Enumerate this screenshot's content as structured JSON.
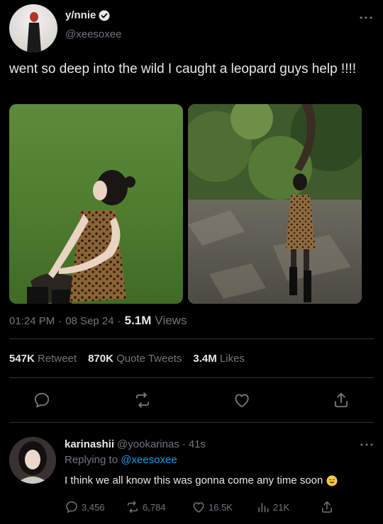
{
  "tweet": {
    "author_name": "y/nnie",
    "author_handle": "@xeesoxee",
    "text": "went so deep into the wild I caught a leopard guys help !!!!",
    "time": "01:24 PM",
    "date": "08 Sep 24",
    "views_count": "5.1M",
    "views_label": "Views",
    "retweets_count": "547K",
    "retweets_label": "Retweet",
    "quotes_count": "870K",
    "quotes_label": "Quote Tweets",
    "likes_count": "3.4M",
    "likes_label": "Likes"
  },
  "reply": {
    "author_name": "karinashii",
    "author_handle": "@yookarinas",
    "time_ago": "41s",
    "replying_prefix": "Replying to",
    "replying_to": "@xeesoxee",
    "text": "I think we all know this was gonna come any time soon",
    "replies": "3,456",
    "retweets": "6,784",
    "likes": "16.5K",
    "views": "21K"
  },
  "colors": {
    "background": "#000000",
    "text_primary": "#e7e9ea",
    "text_secondary": "#71767b",
    "accent": "#1d9bf0",
    "divider": "#2f3336"
  },
  "icons": [
    "verified-badge-icon",
    "more-icon",
    "reply-icon",
    "retweet-icon",
    "like-icon",
    "share-icon",
    "views-icon",
    "grinning-sweat-emoji-icon"
  ]
}
